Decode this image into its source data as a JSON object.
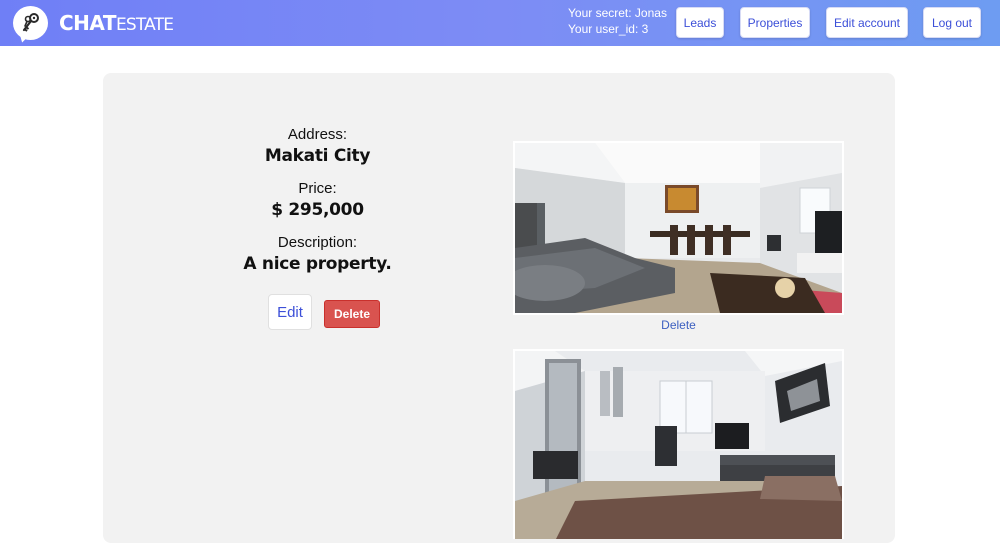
{
  "brand": {
    "part1": "CHAT",
    "part2": "ESTATE"
  },
  "user": {
    "secret_text": "Your secret: Jonas",
    "user_id_text": "Your user_id: 3"
  },
  "nav": {
    "leads": "Leads",
    "properties": "Properties",
    "edit_account": "Edit account",
    "logout": "Log out"
  },
  "property": {
    "address_label": "Address:",
    "address": "Makati City",
    "price_label": "Price:",
    "price": "$ 295,000",
    "description_label": "Description:",
    "description": "A nice property."
  },
  "actions": {
    "edit": "Edit",
    "delete": "Delete"
  },
  "photos": [
    {
      "delete_label": "Delete",
      "icon": "living-room-photo"
    },
    {
      "icon": "bedroom-photo"
    }
  ],
  "colors": {
    "header_gradient_start": "#6f7ff6",
    "header_gradient_end": "#6e9cf2",
    "accent": "#3c4fd8",
    "danger": "#d9534f",
    "card_bg": "#f2f2f2"
  }
}
